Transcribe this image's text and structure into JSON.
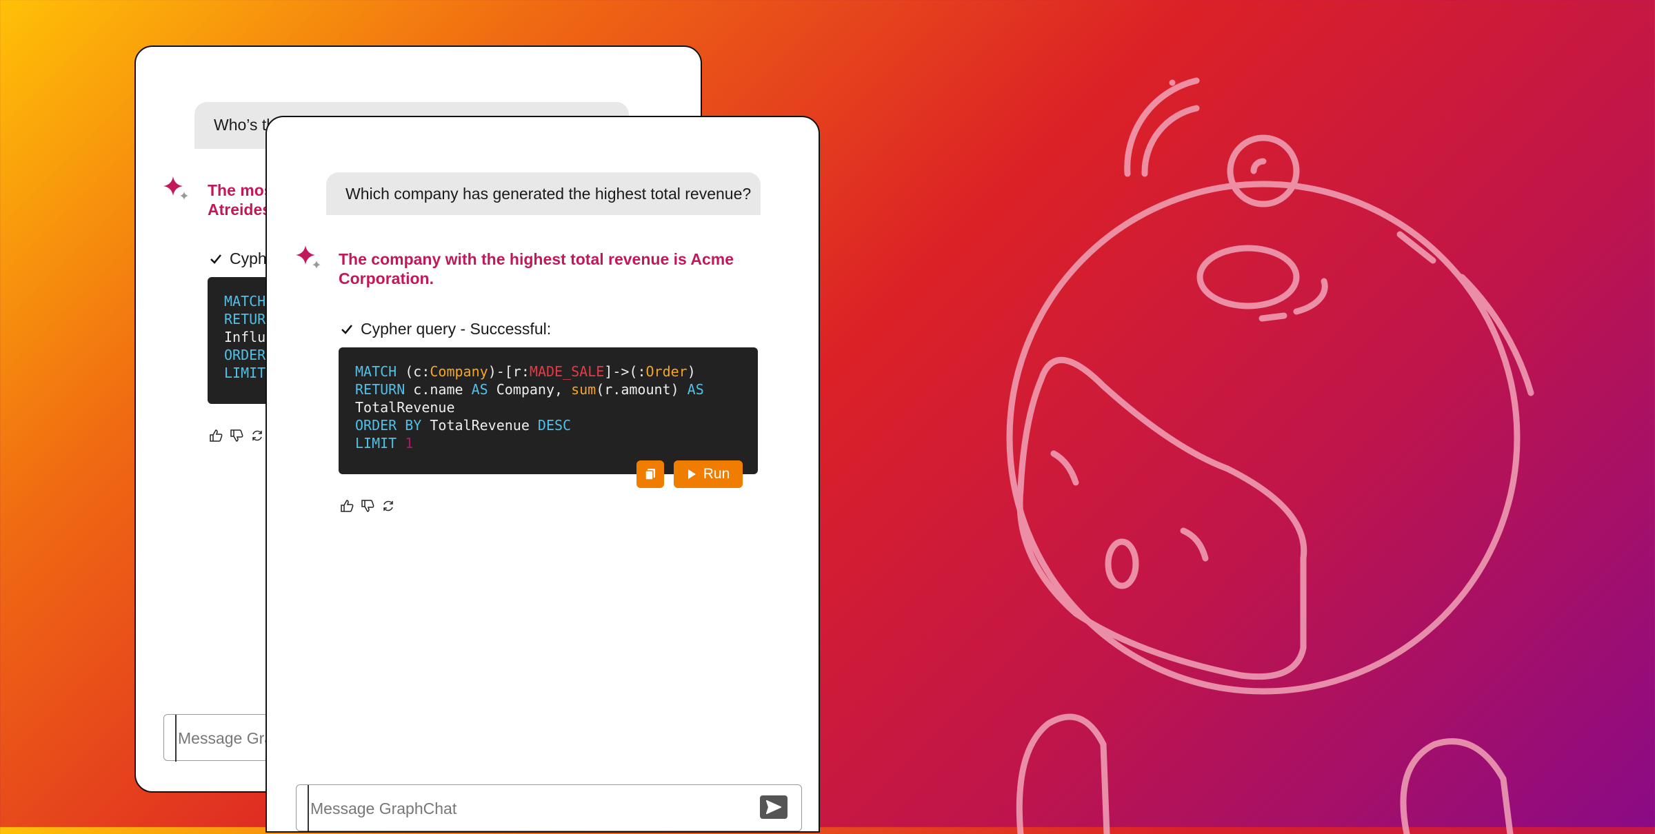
{
  "back_window": {
    "user_message": "Who’s th",
    "answer_line1": "The mos",
    "answer_line2": "Atreides",
    "status_label": "Cyph",
    "code_lines": [
      "MATCH",
      "RETUR",
      "Influ",
      "ORDER",
      "LIMIT"
    ],
    "input_placeholder": "Message Gra"
  },
  "front_window": {
    "user_message": "Which company has generated the highest total revenue?",
    "answer": "The company with the highest total revenue is Acme Corporation.",
    "status_label": "Cypher query -  Successful:",
    "run_label": "Run",
    "input_placeholder": "Message GraphChat"
  },
  "colors": {
    "accent": "#f07d00",
    "answer_text": "#c2185b",
    "code_bg": "#222222",
    "code_keyword": "#4fc1e9",
    "code_label": "#f5a623",
    "code_relation": "#e63946"
  },
  "icons": [
    "sparkle-icon",
    "check-icon",
    "thumbs-up-icon",
    "thumbs-down-icon",
    "regenerate-icon",
    "copy-icon",
    "play-icon",
    "send-icon",
    "robot-illustration"
  ]
}
